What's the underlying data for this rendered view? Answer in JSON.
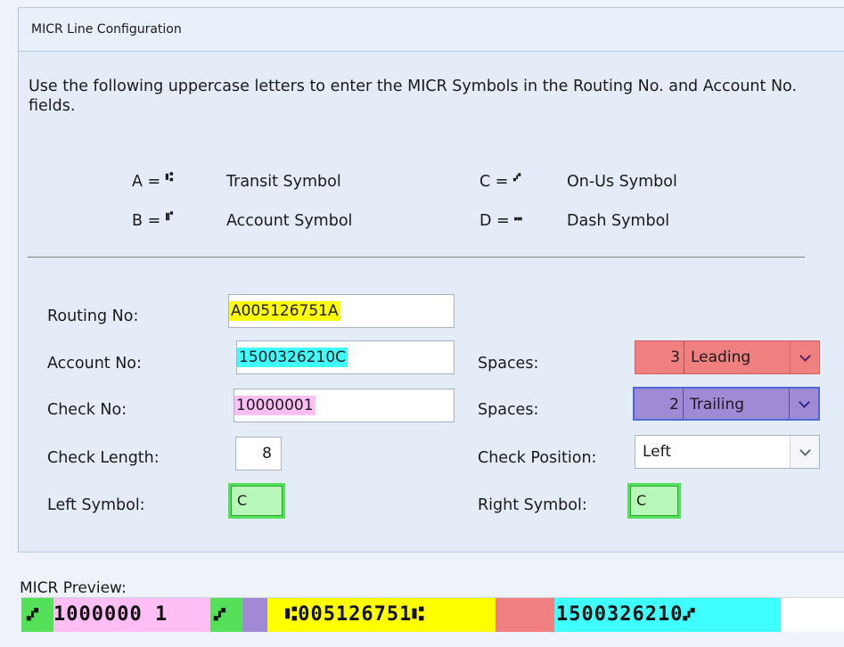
{
  "panel": {
    "title": "MICR Line Configuration",
    "intro": "Use the following uppercase letters to enter the MICR Symbols in the Routing No. and Account No. fields."
  },
  "legend": [
    {
      "eq": "A =",
      "glyph": "⑆",
      "desc": "Transit Symbol"
    },
    {
      "eq": "B =",
      "glyph": "⑈",
      "desc": "Account Symbol"
    },
    {
      "eq": "C =",
      "glyph": "⑇",
      "desc": "On-Us Symbol"
    },
    {
      "eq": "D =",
      "glyph": "⑉",
      "desc": "Dash Symbol"
    }
  ],
  "form": {
    "routing_label": "Routing No:",
    "routing_value": "A005126751A",
    "account_label": "Account No:",
    "account_value": "1500326210C",
    "check_label": "Check No:",
    "check_value": "10000001",
    "check_length_label": "Check Length:",
    "check_length_value": "8",
    "left_symbol_label": "Left Symbol:",
    "left_symbol_value": "C",
    "spaces1_label": "Spaces:",
    "spaces1_count": "3",
    "spaces1_mode": "Leading",
    "spaces2_label": "Spaces:",
    "spaces2_count": "2",
    "spaces2_mode": "Trailing",
    "check_position_label": "Check Position:",
    "check_position_value": "Left",
    "right_symbol_label": "Right Symbol:",
    "right_symbol_value": "C"
  },
  "preview": {
    "label": "MICR Preview:",
    "seg_left_symbol": "⑇",
    "seg_check": "1000000 1",
    "seg_check_end": "⑇",
    "seg_routing": "⑆005126751⑆",
    "seg_account": "1500326210⑇"
  },
  "colors": {
    "routing": "#ffff00",
    "account": "#40ffff",
    "check": "#ffbff5",
    "symbol": "#55e05a",
    "leading_spaces": "#f08080",
    "trailing_spaces": "#a08ad6"
  }
}
